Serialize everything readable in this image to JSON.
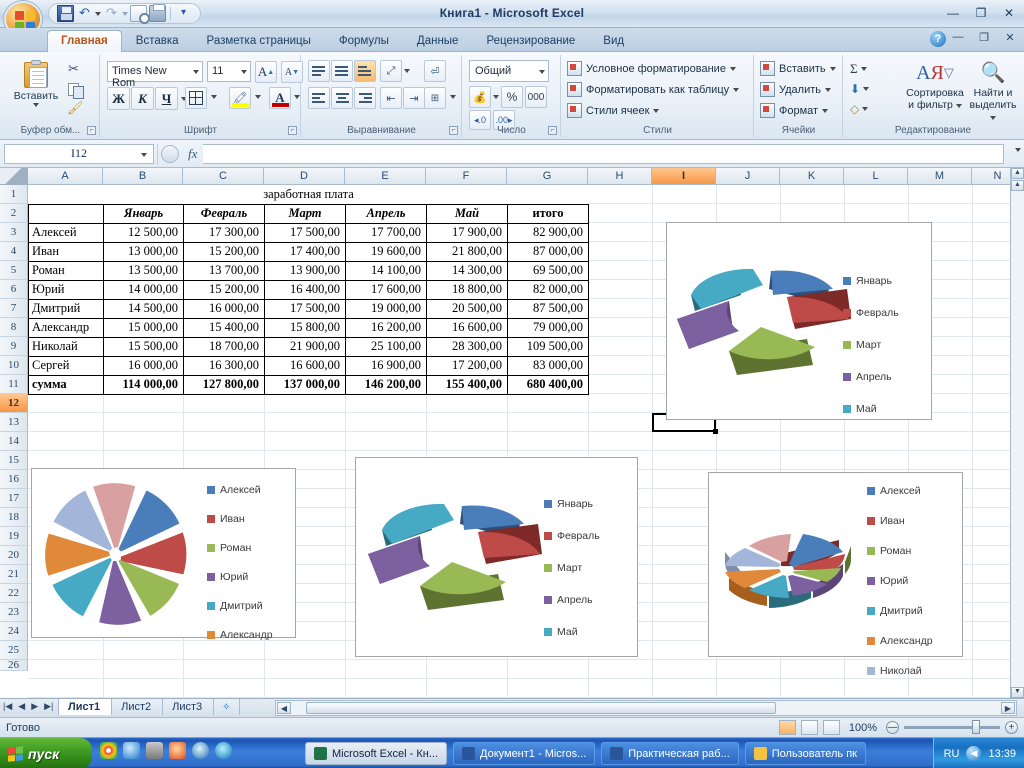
{
  "window": {
    "title": "Книга1 - Microsoft Excel",
    "minimize": "—",
    "restore": "❐",
    "close": "✕"
  },
  "quick_access": {
    "save_icon": "save-icon",
    "undo_icon": "undo-icon",
    "redo_icon": "redo-icon",
    "print_preview_icon": "print-preview-icon",
    "print_icon": "print-icon",
    "customize_icon": "customize-qat-icon"
  },
  "ribbon_tabs": [
    {
      "label": "Главная",
      "active": true
    },
    {
      "label": "Вставка",
      "active": false
    },
    {
      "label": "Разметка страницы",
      "active": false
    },
    {
      "label": "Формулы",
      "active": false
    },
    {
      "label": "Данные",
      "active": false
    },
    {
      "label": "Рецензирование",
      "active": false
    },
    {
      "label": "Вид",
      "active": false
    }
  ],
  "ribbon": {
    "clipboard": {
      "group_label": "Буфер обм...",
      "paste_label": "Вставить",
      "cut_icon": "scissors-icon",
      "copy_icon": "copy-icon",
      "format_painter_icon": "format-painter-icon"
    },
    "font": {
      "group_label": "Шрифт",
      "font_name": "Times New Rom",
      "font_size": "11",
      "grow_font": "A",
      "shrink_font": "A",
      "bold": "Ж",
      "italic": "К",
      "underline": "Ч",
      "borders_icon": "borders-icon",
      "fill_color_icon": "fill-color-icon",
      "font_color_icon": "font-color-icon",
      "fill_color": "#ffff00",
      "font_color": "#c00000"
    },
    "alignment": {
      "group_label": "Выравнивание",
      "top_align_icon": "align-top-icon",
      "middle_align_icon": "align-middle-icon",
      "bottom_align_icon": "align-bottom-icon",
      "orientation_icon": "text-orientation-icon",
      "align_left_icon": "align-left-icon",
      "align_center_icon": "align-center-icon",
      "align_right_icon": "align-right-icon",
      "decrease_indent_icon": "decrease-indent-icon",
      "increase_indent_icon": "increase-indent-icon",
      "wrap_text_icon": "wrap-text-icon",
      "merge_cells_icon": "merge-cells-icon"
    },
    "number": {
      "group_label": "Число",
      "format": "Общий",
      "currency_icon": "currency-icon",
      "percent": "%",
      "thousands": "000",
      "decrease_decimal_icon": "decrease-decimal-icon",
      "increase_decimal_icon": "increase-decimal-icon"
    },
    "styles": {
      "group_label": "Стили",
      "items": [
        "Условное форматирование",
        "Форматировать как таблицу",
        "Стили ячеек"
      ]
    },
    "cells": {
      "group_label": "Ячейки",
      "items": [
        "Вставить",
        "Удалить",
        "Формат"
      ]
    },
    "editing": {
      "group_label": "Редактирование",
      "autosum_icon": "autosum-icon",
      "fill_icon": "fill-series-icon",
      "clear_icon": "clear-icon",
      "sort_filter": "Сортировка\nи фильтр",
      "sort_line1": "Сортировка",
      "sort_line2": "и фильтр",
      "find_line1": "Найти и",
      "find_line2": "выделить"
    },
    "help_icon": "help-icon"
  },
  "formula_bar": {
    "name_box": "I12",
    "fx_label": "fx",
    "value": "",
    "expand_icon": "expand-formula-bar-icon"
  },
  "grid": {
    "columns": [
      "A",
      "B",
      "C",
      "D",
      "E",
      "F",
      "G",
      "H",
      "I",
      "J",
      "K",
      "L",
      "M",
      "N"
    ],
    "selected_column": "I",
    "selected_row": 12,
    "selected_cell": "I12",
    "rows": [
      1,
      2,
      3,
      4,
      5,
      6,
      7,
      8,
      9,
      10,
      11,
      12,
      13,
      14,
      15,
      16,
      17,
      18,
      19,
      20,
      21,
      22,
      23,
      24,
      25,
      26
    ]
  },
  "sheet_table": {
    "title": "заработная плата",
    "headers": [
      "",
      "Январь",
      "Февраль",
      "Март",
      "Апрель",
      "Май",
      "итого"
    ],
    "rows": [
      [
        "Алексей",
        "12 500,00",
        "17 300,00",
        "17 500,00",
        "17 700,00",
        "17 900,00",
        "82 900,00"
      ],
      [
        "Иван",
        "13 000,00",
        "15 200,00",
        "17 400,00",
        "19 600,00",
        "21 800,00",
        "87 000,00"
      ],
      [
        "Роман",
        "13 500,00",
        "13 700,00",
        "13 900,00",
        "14 100,00",
        "14 300,00",
        "69 500,00"
      ],
      [
        "Юрий",
        "14 000,00",
        "15 200,00",
        "16 400,00",
        "17 600,00",
        "18 800,00",
        "82 000,00"
      ],
      [
        "Дмитрий",
        "14 500,00",
        "16 000,00",
        "17 500,00",
        "19 000,00",
        "20 500,00",
        "87 500,00"
      ],
      [
        "Александр",
        "15 000,00",
        "15 400,00",
        "15 800,00",
        "16 200,00",
        "16 600,00",
        "79 000,00"
      ],
      [
        "Николай",
        "15 500,00",
        "18 700,00",
        "21 900,00",
        "25 100,00",
        "28 300,00",
        "109 500,00"
      ],
      [
        "Сергей",
        "16 000,00",
        "16 300,00",
        "16 600,00",
        "16 900,00",
        "17 200,00",
        "83 000,00"
      ]
    ],
    "total_row": [
      "сумма",
      "114 000,00",
      "127 800,00",
      "137 000,00",
      "146 200,00",
      "155 400,00",
      "680 400,00"
    ]
  },
  "chart_data": [
    {
      "id": "chart-months-top-right",
      "type": "pie",
      "variant": "3d-exploded",
      "title": "",
      "categories": [
        "Январь",
        "Февраль",
        "Март",
        "Апрель",
        "Май"
      ],
      "values": [
        114000,
        127800,
        137000,
        146200,
        155400
      ],
      "colors": [
        "#4a7ebb",
        "#be4b48",
        "#98b954",
        "#7d60a0",
        "#46aac5"
      ],
      "legend_position": "right"
    },
    {
      "id": "chart-people-bottom-left",
      "type": "pie",
      "variant": "2d-exploded",
      "title": "",
      "categories": [
        "Алексей",
        "Иван",
        "Роман",
        "Юрий",
        "Дмитрий",
        "Александр",
        "Николай",
        "Сергей"
      ],
      "values": [
        82900,
        87000,
        69500,
        82000,
        87500,
        79000,
        109500,
        83000
      ],
      "colors": [
        "#4a7ebb",
        "#be4b48",
        "#98b954",
        "#7d60a0",
        "#46aac5",
        "#e0893b",
        "#a3b5d8",
        "#d8a0a0"
      ],
      "legend_visible": [
        "Алексей",
        "Иван",
        "Роман",
        "Юрий",
        "Дмитрий",
        "Александр"
      ],
      "legend_position": "right"
    },
    {
      "id": "chart-months-bottom-middle",
      "type": "pie",
      "variant": "3d-exploded",
      "title": "",
      "categories": [
        "Январь",
        "Февраль",
        "Март",
        "Апрель",
        "Май"
      ],
      "values": [
        114000,
        127800,
        137000,
        146200,
        155400
      ],
      "colors": [
        "#4a7ebb",
        "#be4b48",
        "#98b954",
        "#7d60a0",
        "#46aac5"
      ],
      "legend_position": "right"
    },
    {
      "id": "chart-people-bottom-right",
      "type": "pie",
      "variant": "3d-exploded",
      "title": "",
      "categories": [
        "Алексей",
        "Иван",
        "Роман",
        "Юрий",
        "Дмитрий",
        "Александр",
        "Николай",
        "Сергей"
      ],
      "values": [
        82900,
        87000,
        69500,
        82000,
        87500,
        79000,
        109500,
        83000
      ],
      "colors": [
        "#4a7ebb",
        "#be4b48",
        "#98b954",
        "#7d60a0",
        "#46aac5",
        "#e0893b",
        "#a3b5d8",
        "#d8a0a0"
      ],
      "legend_visible": [
        "Алексей",
        "Иван",
        "Роман",
        "Юрий",
        "Дмитрий",
        "Александр",
        "Николай"
      ],
      "legend_position": "right"
    }
  ],
  "sheet_tabs": [
    {
      "label": "Лист1",
      "active": true
    },
    {
      "label": "Лист2",
      "active": false
    },
    {
      "label": "Лист3",
      "active": false
    }
  ],
  "sheet_nav": {
    "first": "|◀",
    "prev": "◀",
    "next": "▶",
    "last": "▶|",
    "insert_sheet_icon": "insert-sheet-icon"
  },
  "status_bar": {
    "status": "Готово",
    "zoom": "100%",
    "normal_view_icon": "normal-view-icon",
    "page_layout_icon": "page-layout-view-icon",
    "page_break_icon": "page-break-view-icon",
    "zoom_out": "—",
    "zoom_in": "+"
  },
  "taskbar": {
    "start_label": "пуск",
    "quick_launch": [
      "chrome-icon",
      "ie-icon",
      "media-player-icon",
      "firefox-icon",
      "opera-icon",
      "player-icon"
    ],
    "tasks": [
      {
        "label": "Microsoft Excel - Кн...",
        "icon": "excel-icon",
        "color": "#1f7246",
        "active": true
      },
      {
        "label": "Документ1 - Micros...",
        "icon": "word-icon",
        "color": "#2a5699",
        "active": false
      },
      {
        "label": "Практическая раб...",
        "icon": "word-icon",
        "color": "#2a5699",
        "active": false
      },
      {
        "label": "Пользователь пк",
        "icon": "folder-icon",
        "color": "#f5c242",
        "active": false
      }
    ],
    "language": "RU",
    "tray_chevron_icon": "show-hidden-icons-icon",
    "clock": "13:39"
  }
}
